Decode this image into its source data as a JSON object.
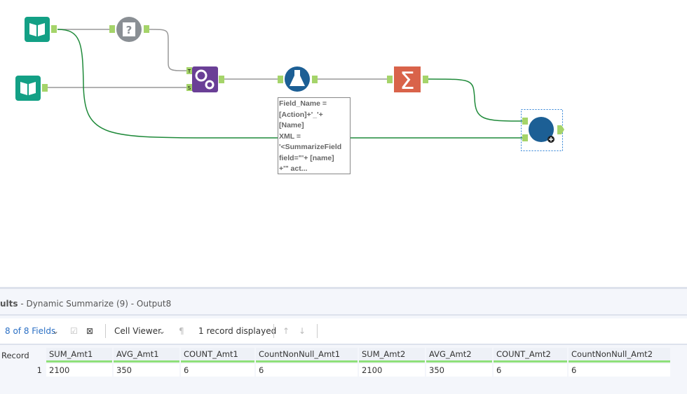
{
  "canvas": {
    "tools": [
      {
        "name": "input-data-1",
        "icon": "book-icon",
        "color": "#13a085"
      },
      {
        "name": "input-data-2",
        "icon": "book-icon",
        "color": "#13a085"
      },
      {
        "name": "test-tool",
        "icon": "question-gear-icon",
        "color": "#8a8f94"
      },
      {
        "name": "macro-tool",
        "icon": "gears-icon",
        "color": "#6a3f96"
      },
      {
        "name": "formula-tool",
        "icon": "flask-icon",
        "color": "#1c5f95"
      },
      {
        "name": "summarize-tool",
        "icon": "sigma-icon",
        "color": "#d9634a"
      },
      {
        "name": "dynamic-summarize-tool",
        "icon": "circle-icon",
        "color": "#1c5f95"
      }
    ],
    "anchors": {
      "macro_t": "T",
      "macro_s": "S"
    },
    "annotation": "Field_Name =\n[Action]+'_'+\n[Name]\nXML =\n'<SummarizeField\nfield=\"'+ [name]\n+'\" act..."
  },
  "results": {
    "title": "ults",
    "subtitle": " - Dynamic Summarize (9) - Output8",
    "fields_label": "8 of 8 Fields",
    "cell_viewer": "Cell Viewer",
    "record_count": "1 record displayed",
    "columns": [
      "Record",
      "SUM_Amt1",
      "AVG_Amt1",
      "COUNT_Amt1",
      "CountNonNull_Amt1",
      "SUM_Amt2",
      "AVG_Amt2",
      "COUNT_Amt2",
      "CountNonNull_Amt2"
    ],
    "rows": [
      [
        "1",
        "2100",
        "350",
        "6",
        "6",
        "2100",
        "350",
        "6",
        "6"
      ]
    ]
  }
}
